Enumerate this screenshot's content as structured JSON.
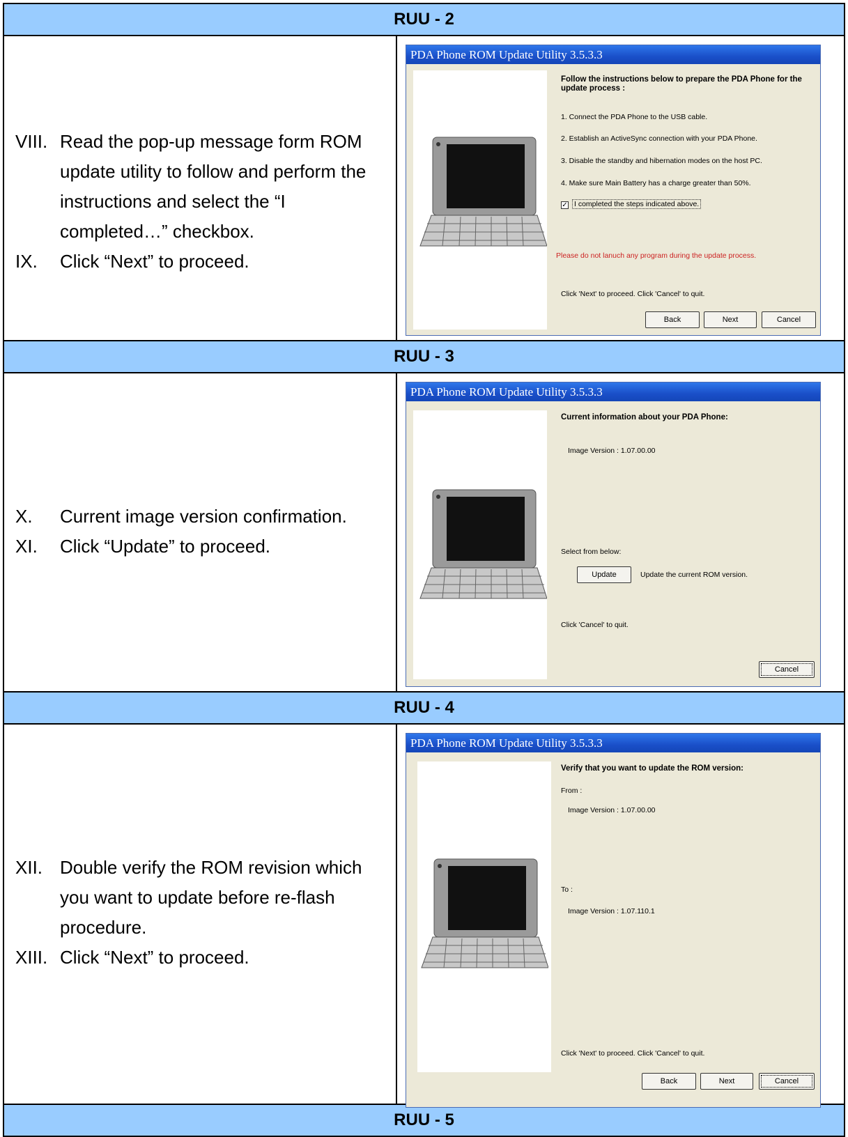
{
  "sections": [
    {
      "header": "RUU - 2",
      "steps": [
        {
          "num": "VIII.",
          "text": "Read the pop-up message form ROM update utility to follow and perform the instructions and select the “I completed…” checkbox."
        },
        {
          "num": "IX.",
          "text": "Click “Next” to proceed."
        }
      ],
      "window": {
        "title": "PDA Phone ROM Update Utility 3.5.3.3",
        "heading": "Follow the instructions below to prepare the PDA Phone for the update process :",
        "items": [
          "1. Connect the PDA Phone to the USB cable.",
          "2. Establish an ActiveSync connection with your PDA Phone.",
          "3. Disable the standby and hibernation modes on the host PC.",
          "4. Make sure Main Battery has a charge greater than 50%."
        ],
        "checkbox_label": "I completed the steps indicated above.",
        "checkbox_checked": true,
        "warning": "Please do not lanuch any program during the update process.",
        "footer": "Click 'Next' to proceed. Click 'Cancel' to quit.",
        "buttons": {
          "back": "Back",
          "next": "Next",
          "cancel": "Cancel"
        }
      }
    },
    {
      "header": "RUU - 3",
      "steps": [
        {
          "num": "X.",
          "text": "Current image version confirmation."
        },
        {
          "num": "XI.",
          "text": "Click “Update” to proceed."
        }
      ],
      "window": {
        "title": "PDA Phone ROM Update Utility 3.5.3.3",
        "heading": "Current information about your PDA Phone:",
        "image_version": "Image Version : 1.07.00.00",
        "select_label": "Select from below:",
        "update_button": "Update",
        "update_desc": "Update the current ROM version.",
        "footer": "Click 'Cancel' to quit.",
        "cancel": "Cancel"
      }
    },
    {
      "header": "RUU - 4",
      "steps": [
        {
          "num": "XII.",
          "text": "Double verify the ROM revision which you want to update before re-flash procedure."
        },
        {
          "num": "XIII.",
          "text": "Click “Next” to proceed."
        }
      ],
      "window": {
        "title": "PDA Phone ROM Update Utility 3.5.3.3",
        "heading": "Verify that you want to update the ROM version:",
        "from_label": "From :",
        "from_version": "Image Version : 1.07.00.00",
        "to_label": "To :",
        "to_version": "Image Version : 1.07.110.1",
        "footer": "Click 'Next' to proceed. Click 'Cancel' to quit.",
        "buttons": {
          "back": "Back",
          "next": "Next",
          "cancel": "Cancel"
        }
      }
    },
    {
      "header": "RUU - 5"
    }
  ]
}
